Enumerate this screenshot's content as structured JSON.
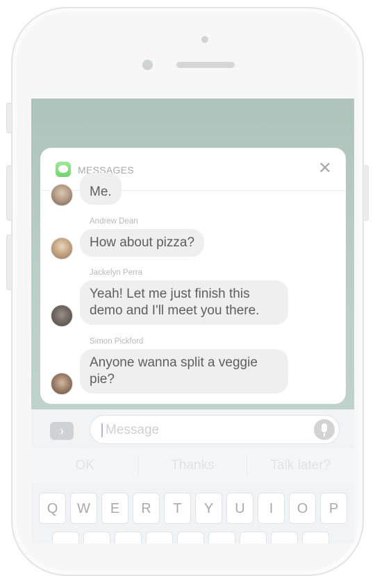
{
  "notification": {
    "app_name": "MESSAGES",
    "close_icon": "close-icon",
    "messages": [
      {
        "sender": "",
        "text": "Me."
      },
      {
        "sender": "Andrew Dean",
        "text": "How about pizza?"
      },
      {
        "sender": "Jackelyn Perra",
        "lines": [
          "Yeah! Let me just finish this",
          "demo and I'll meet you there."
        ]
      },
      {
        "sender": "Simon Pickford",
        "lines": [
          "Anyone wanna split a veggie",
          "pie?"
        ]
      }
    ]
  },
  "input_bar": {
    "apps_icon": "chevron-right-icon",
    "placeholder": "Message",
    "mic_icon": "microphone-icon"
  },
  "quicktype": [
    "OK",
    "Thanks",
    "Talk later?"
  ],
  "keyboard": {
    "row1": [
      "Q",
      "W",
      "E",
      "R",
      "T",
      "Y",
      "U",
      "I",
      "O",
      "P"
    ]
  },
  "colors": {
    "app_icon": "#72d46d",
    "bubble": "#efefef",
    "screen_bg": "#b9cdc6"
  }
}
